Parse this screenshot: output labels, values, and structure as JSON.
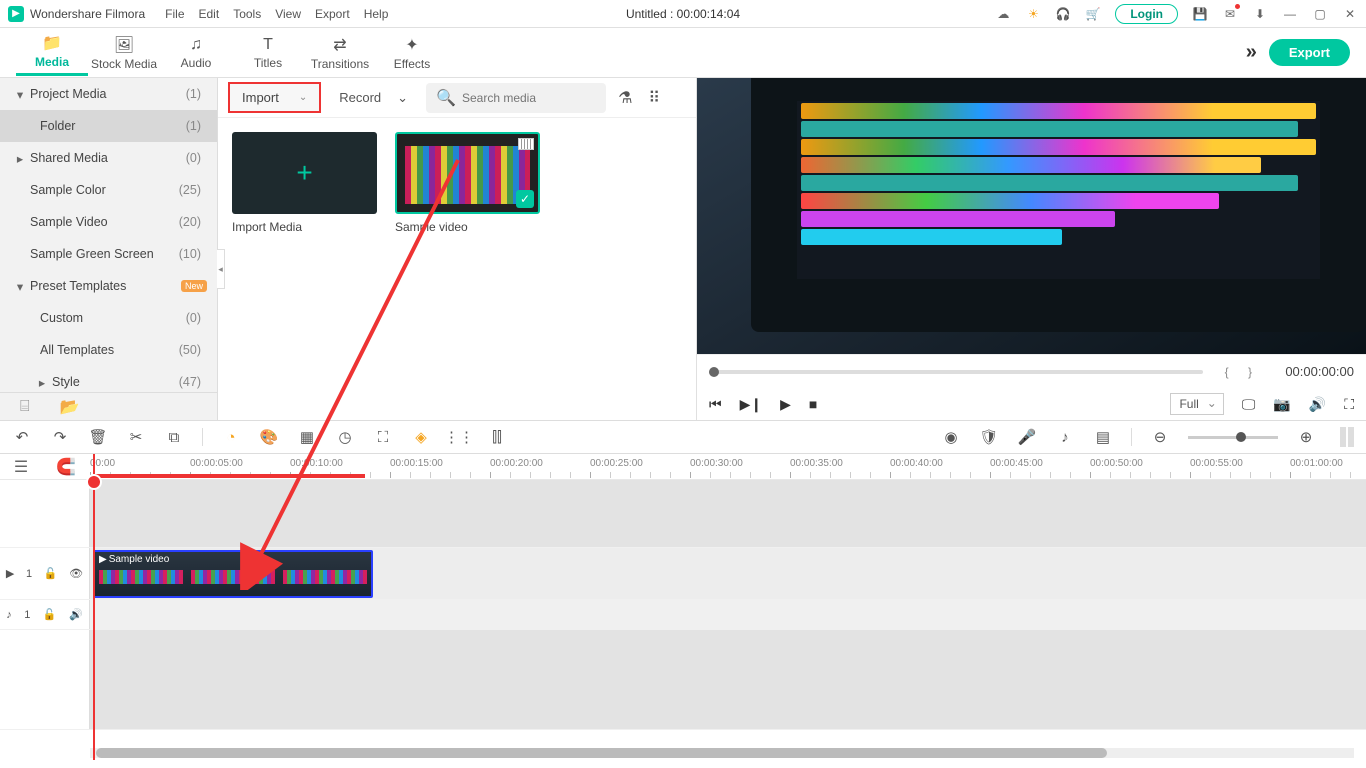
{
  "titlebar": {
    "app_name": "Wondershare Filmora",
    "menus": [
      "File",
      "Edit",
      "Tools",
      "View",
      "Export",
      "Help"
    ],
    "doc_title": "Untitled : 00:00:14:04",
    "login": "Login"
  },
  "tabs": [
    {
      "label": "Media",
      "icon": "📁",
      "active": true
    },
    {
      "label": "Stock Media",
      "icon": "🖼",
      "active": false
    },
    {
      "label": "Audio",
      "icon": "♫",
      "active": false
    },
    {
      "label": "Titles",
      "icon": "T",
      "active": false
    },
    {
      "label": "Transitions",
      "icon": "⇄",
      "active": false
    },
    {
      "label": "Effects",
      "icon": "✦",
      "active": false
    }
  ],
  "export_label": "Export",
  "sidebar": {
    "items": [
      {
        "label": "Project Media",
        "count": "(1)",
        "chev": "▾",
        "lvl": 0,
        "sel": false
      },
      {
        "label": "Folder",
        "count": "(1)",
        "chev": "",
        "lvl": 1,
        "sel": true
      },
      {
        "label": "Shared Media",
        "count": "(0)",
        "chev": "▸",
        "lvl": 0,
        "sel": false
      },
      {
        "label": "Sample Color",
        "count": "(25)",
        "chev": "",
        "lvl": 0,
        "sel": false,
        "nochev": true
      },
      {
        "label": "Sample Video",
        "count": "(20)",
        "chev": "",
        "lvl": 0,
        "sel": false,
        "nochev": true
      },
      {
        "label": "Sample Green Screen",
        "count": "(10)",
        "chev": "",
        "lvl": 0,
        "sel": false,
        "nochev": true
      },
      {
        "label": "Preset Templates",
        "count": "",
        "chev": "▾",
        "lvl": 0,
        "sel": false,
        "badge": "New"
      },
      {
        "label": "Custom",
        "count": "(0)",
        "chev": "",
        "lvl": 1,
        "sel": false
      },
      {
        "label": "All Templates",
        "count": "(50)",
        "chev": "",
        "lvl": 1,
        "sel": false
      },
      {
        "label": "Style",
        "count": "(47)",
        "chev": "▸",
        "lvl": 1,
        "sel": false
      }
    ]
  },
  "mediapanel": {
    "import_label": "Import",
    "record_label": "Record",
    "search_placeholder": "Search media",
    "cards": [
      {
        "label": "Import Media",
        "type": "import"
      },
      {
        "label": "Sample video",
        "type": "sample"
      }
    ]
  },
  "preview": {
    "timecode": "00:00:00:00",
    "quality": "Full"
  },
  "timeline": {
    "ticks": [
      "00:00",
      "00:00:05:00",
      "00:00:10:00",
      "00:00:15:00",
      "00:00:20:00",
      "00:00:25:00",
      "00:00:30:00",
      "00:00:35:00",
      "00:00:40:00",
      "00:00:45:00",
      "00:00:50:00",
      "00:00:55:00",
      "00:01:00:00"
    ],
    "video_track": "1",
    "audio_track": "1",
    "clip_label": "Sample video"
  }
}
